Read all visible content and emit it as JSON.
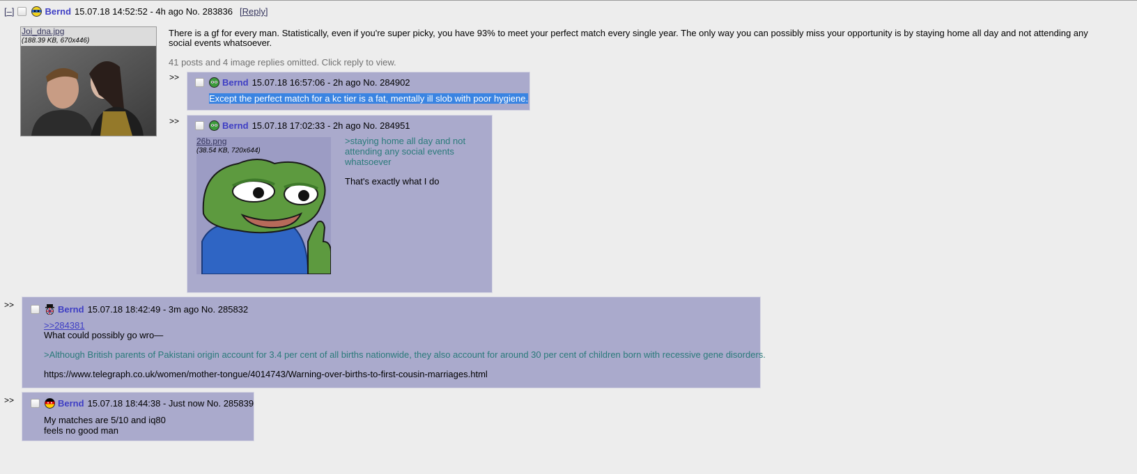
{
  "op": {
    "hide_label": "[–]",
    "name": "Bernd",
    "meta": "15.07.18 14:52:52 - 4h ago No. 283836",
    "reply_link": "[Reply]",
    "file": {
      "name": "Joi_dna.jpg",
      "info": "(188.39 KB, 670x446)"
    },
    "body_line1": "There is a gf for every man. Statistically, even if you're super picky, you have 93% to meet your perfect match every single year. The only way you can possibly miss your opportunity is by staying home all day and not attending any",
    "body_line2": "social events whatsoever.",
    "omitted": "41 posts and 4 image replies omitted. Click reply to view."
  },
  "replies": [
    {
      "arrows": ">>",
      "name": "Bernd",
      "meta": "15.07.18 16:57:06 - 2h ago No. 284902",
      "text": "Except the perfect match for a kc tier is a fat, mentally ill slob with poor hygiene."
    },
    {
      "arrows": ">>",
      "name": "Bernd",
      "meta": "15.07.18 17:02:33 - 2h ago No. 284951",
      "file": {
        "name": "26b.png",
        "info": "(38.54 KB, 720x644)"
      },
      "green1": ">staying home all day and not",
      "green2": "attending any social events",
      "green3": "whatsoever",
      "text": "That's exactly what I do"
    },
    {
      "arrows": ">>",
      "name": "Bernd",
      "meta": "15.07.18 18:42:49 - 3m ago No. 285832",
      "quote_link": ">>284381",
      "line1": "What could possibly go wro—",
      "green": ">Although British parents of Pakistani origin account for 3.4 per cent of all births nationwide, they also account for around 30 per cent of children born with recessive gene disorders.",
      "url": "https://www.telegraph.co.uk/women/mother-tongue/4014743/Warning-over-births-to-first-cousin-marriages.html"
    },
    {
      "arrows": ">>",
      "name": "Bernd",
      "meta": "15.07.18 18:44:38 - Just now No. 285839",
      "line1": "My matches are 5/10 and iq80",
      "line2": "feels no good man"
    }
  ]
}
